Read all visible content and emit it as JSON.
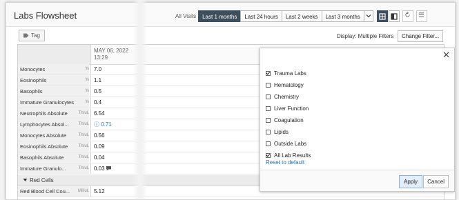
{
  "header": {
    "title": "Labs Flowsheet",
    "all_visits_label": "All Visits",
    "time_filters": [
      "Last 1 months",
      "Last 24 hours",
      "Last 2 weeks",
      "Last 3 months"
    ],
    "active_filter": "Last 1 months"
  },
  "toolbar": {
    "tag_label": "Tag",
    "display_text": "Display: Multiple Filters",
    "change_filter_label": "Change Filter..."
  },
  "grid": {
    "date": "MAY 06, 2022",
    "time": "13:29",
    "rows": [
      {
        "name": "Monocytes",
        "unit": "%",
        "value": "7.0"
      },
      {
        "name": "Eosinophils",
        "unit": "%",
        "value": "1.1"
      },
      {
        "name": "Basophils",
        "unit": "%",
        "value": "0.5"
      },
      {
        "name": "Immature Granulocytes",
        "unit": "%",
        "value": "0.4"
      },
      {
        "name": "Neutrophils Absolute",
        "unit": "Th/uL",
        "value": "6.54"
      },
      {
        "name": "Lymphocytes Absol...",
        "unit": "Th/uL",
        "value": "0.71",
        "flag": "ⓘ"
      },
      {
        "name": "Monocytes Absolute",
        "unit": "Th/uL",
        "value": "0.56"
      },
      {
        "name": "Eosinophils Absolute",
        "unit": "Th/uL",
        "value": "0.09"
      },
      {
        "name": "Basophils Absolute",
        "unit": "Th/uL",
        "value": "0.04"
      },
      {
        "name": "Immature Granulo...",
        "unit": "Th/uL",
        "value": "0.03"
      }
    ],
    "group_label": "Red Cells",
    "after_group": {
      "name": "Red Blood Cell Cou...",
      "unit": "Mil/uL",
      "value": "5.12"
    }
  },
  "filter_panel": {
    "options": [
      {
        "label": "Trauma Labs",
        "checked": true
      },
      {
        "label": "Hematology",
        "checked": false
      },
      {
        "label": "Chemistry",
        "checked": false
      },
      {
        "label": "Liver Function",
        "checked": false
      },
      {
        "label": "Coagulation",
        "checked": false
      },
      {
        "label": "Lipids",
        "checked": false
      },
      {
        "label": "Outside Labs",
        "checked": false
      },
      {
        "label": "All Lab Results",
        "checked": true
      }
    ],
    "reset_label": "Reset to default",
    "apply_label": "Apply",
    "cancel_label": "Cancel"
  }
}
